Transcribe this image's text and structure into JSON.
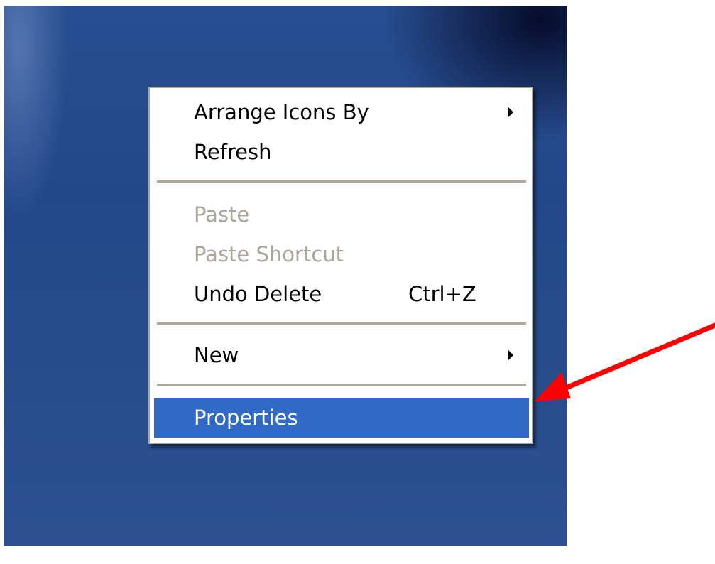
{
  "context_menu": {
    "items": [
      {
        "label": "Arrange Icons By",
        "shortcut": "",
        "submenu": true,
        "enabled": true,
        "highlighted": false
      },
      {
        "label": "Refresh",
        "shortcut": "",
        "submenu": false,
        "enabled": true,
        "highlighted": false
      },
      {
        "label": "Paste",
        "shortcut": "",
        "submenu": false,
        "enabled": false,
        "highlighted": false
      },
      {
        "label": "Paste Shortcut",
        "shortcut": "",
        "submenu": false,
        "enabled": false,
        "highlighted": false
      },
      {
        "label": "Undo Delete",
        "shortcut": "Ctrl+Z",
        "submenu": false,
        "enabled": true,
        "highlighted": false
      },
      {
        "label": "New",
        "shortcut": "",
        "submenu": true,
        "enabled": true,
        "highlighted": false
      },
      {
        "label": "Properties",
        "shortcut": "",
        "submenu": false,
        "enabled": true,
        "highlighted": true
      }
    ]
  },
  "colors": {
    "desktop_background": "#23488a",
    "menu_background": "#ffffff",
    "menu_border": "#a7a69d",
    "highlight": "#316ac5",
    "disabled_text": "#a9a79c",
    "annotation_arrow": "#ff0000"
  },
  "annotation": {
    "icon": "red-pointer-arrow-icon",
    "points_to": "Properties"
  }
}
